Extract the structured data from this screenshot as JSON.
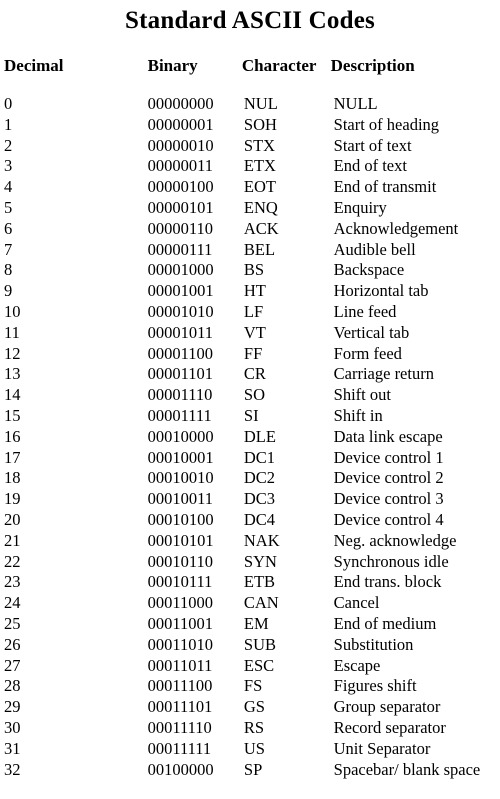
{
  "title": "Standard ASCII Codes",
  "table": {
    "columns": [
      "Decimal",
      "Binary",
      "Character",
      "Description"
    ],
    "rows": [
      {
        "decimal": "0",
        "binary": "00000000",
        "character": "NUL",
        "description": "NULL"
      },
      {
        "decimal": "1",
        "binary": "00000001",
        "character": "SOH",
        "description": "Start of heading"
      },
      {
        "decimal": "2",
        "binary": "00000010",
        "character": "STX",
        "description": "Start of text"
      },
      {
        "decimal": "3",
        "binary": "00000011",
        "character": "ETX",
        "description": "End of text"
      },
      {
        "decimal": "4",
        "binary": "00000100",
        "character": "EOT",
        "description": "End of transmit"
      },
      {
        "decimal": "5",
        "binary": "00000101",
        "character": "ENQ",
        "description": "Enquiry"
      },
      {
        "decimal": "6",
        "binary": "00000110",
        "character": "ACK",
        "description": "Acknowledgement"
      },
      {
        "decimal": "7",
        "binary": "00000111",
        "character": "BEL",
        "description": "Audible bell"
      },
      {
        "decimal": "8",
        "binary": "00001000",
        "character": "BS",
        "description": "Backspace"
      },
      {
        "decimal": "9",
        "binary": "00001001",
        "character": "HT",
        "description": "Horizontal tab"
      },
      {
        "decimal": "10",
        "binary": "00001010",
        "character": "LF",
        "description": "Line feed"
      },
      {
        "decimal": "11",
        "binary": "00001011",
        "character": "VT",
        "description": "Vertical tab"
      },
      {
        "decimal": "12",
        "binary": "00001100",
        "character": "FF",
        "description": "Form feed"
      },
      {
        "decimal": "13",
        "binary": "00001101",
        "character": "CR",
        "description": "Carriage return"
      },
      {
        "decimal": "14",
        "binary": "00001110",
        "character": "SO",
        "description": "Shift out"
      },
      {
        "decimal": "15",
        "binary": "00001111",
        "character": "SI",
        "description": "Shift in"
      },
      {
        "decimal": "16",
        "binary": "00010000",
        "character": "DLE",
        "description": "Data link escape"
      },
      {
        "decimal": "17",
        "binary": "00010001",
        "character": "DC1",
        "description": "Device control 1"
      },
      {
        "decimal": "18",
        "binary": "00010010",
        "character": "DC2",
        "description": "Device control 2"
      },
      {
        "decimal": "19",
        "binary": "00010011",
        "character": "DC3",
        "description": "Device control 3"
      },
      {
        "decimal": "20",
        "binary": "00010100",
        "character": "DC4",
        "description": "Device control 4"
      },
      {
        "decimal": "21",
        "binary": "00010101",
        "character": "NAK",
        "description": "Neg. acknowledge"
      },
      {
        "decimal": "22",
        "binary": "00010110",
        "character": "SYN",
        "description": "Synchronous idle"
      },
      {
        "decimal": "23",
        "binary": "00010111",
        "character": "ETB",
        "description": "End trans. block"
      },
      {
        "decimal": "24",
        "binary": "00011000",
        "character": "CAN",
        "description": "Cancel"
      },
      {
        "decimal": "25",
        "binary": "00011001",
        "character": "EM",
        "description": "End of medium"
      },
      {
        "decimal": "26",
        "binary": "00011010",
        "character": "SUB",
        "description": "Substitution"
      },
      {
        "decimal": "27",
        "binary": "00011011",
        "character": "ESC",
        "description": "Escape"
      },
      {
        "decimal": "28",
        "binary": "00011100",
        "character": "FS",
        "description": "Figures shift"
      },
      {
        "decimal": "29",
        "binary": "00011101",
        "character": "GS",
        "description": "Group separator"
      },
      {
        "decimal": "30",
        "binary": "00011110",
        "character": "RS",
        "description": "Record separator"
      },
      {
        "decimal": "31",
        "binary": "00011111",
        "character": "US",
        "description": "Unit Separator"
      },
      {
        "decimal": "32",
        "binary": "00100000",
        "character": "SP",
        "description": "Spacebar/ blank space"
      }
    ]
  },
  "colors": {
    "background": "#ffffff",
    "text": "#000000"
  }
}
